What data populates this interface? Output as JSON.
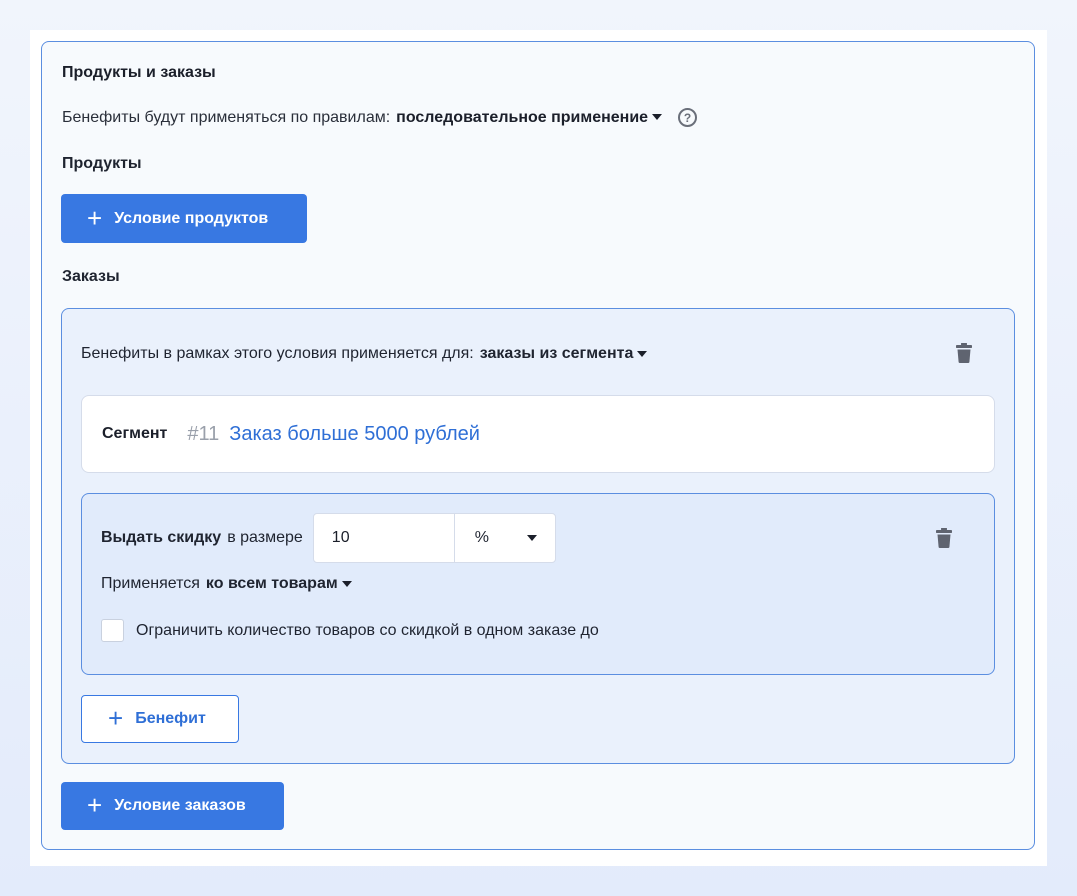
{
  "section": {
    "title": "Продукты и заказы",
    "rules_label": "Бенефиты будут применяться по правилам:",
    "rules_value": "последовательное применение",
    "help": "?"
  },
  "products": {
    "heading": "Продукты",
    "add_button_label": "Условие продуктов"
  },
  "orders": {
    "heading": "Заказы",
    "add_button_label": "Условие заказов",
    "condition": {
      "applies_label": "Бенефиты в рамках этого условия применяется для:",
      "applies_value": "заказы из сегмента",
      "segment": {
        "label": "Сегмент",
        "id": "#11",
        "name": "Заказ больше 5000 рублей"
      },
      "benefit": {
        "action": "Выдать скидку",
        "size_label": "в размере",
        "amount": "10",
        "unit": "%",
        "applies_label": "Применяется",
        "applies_value": "ко всем товарам",
        "limit_label": "Ограничить количество товаров со скидкой в одном заказе до",
        "limit_checked": false
      },
      "add_benefit_label": "Бенефит"
    }
  },
  "icons": {
    "plus": "+",
    "dropdown": "caret-down-icon",
    "delete": "trash-icon",
    "help": "help-circle-icon"
  },
  "colors": {
    "accent": "#3878e2",
    "border": "#5b8ee0",
    "segment_link": "#2f6fd6"
  }
}
